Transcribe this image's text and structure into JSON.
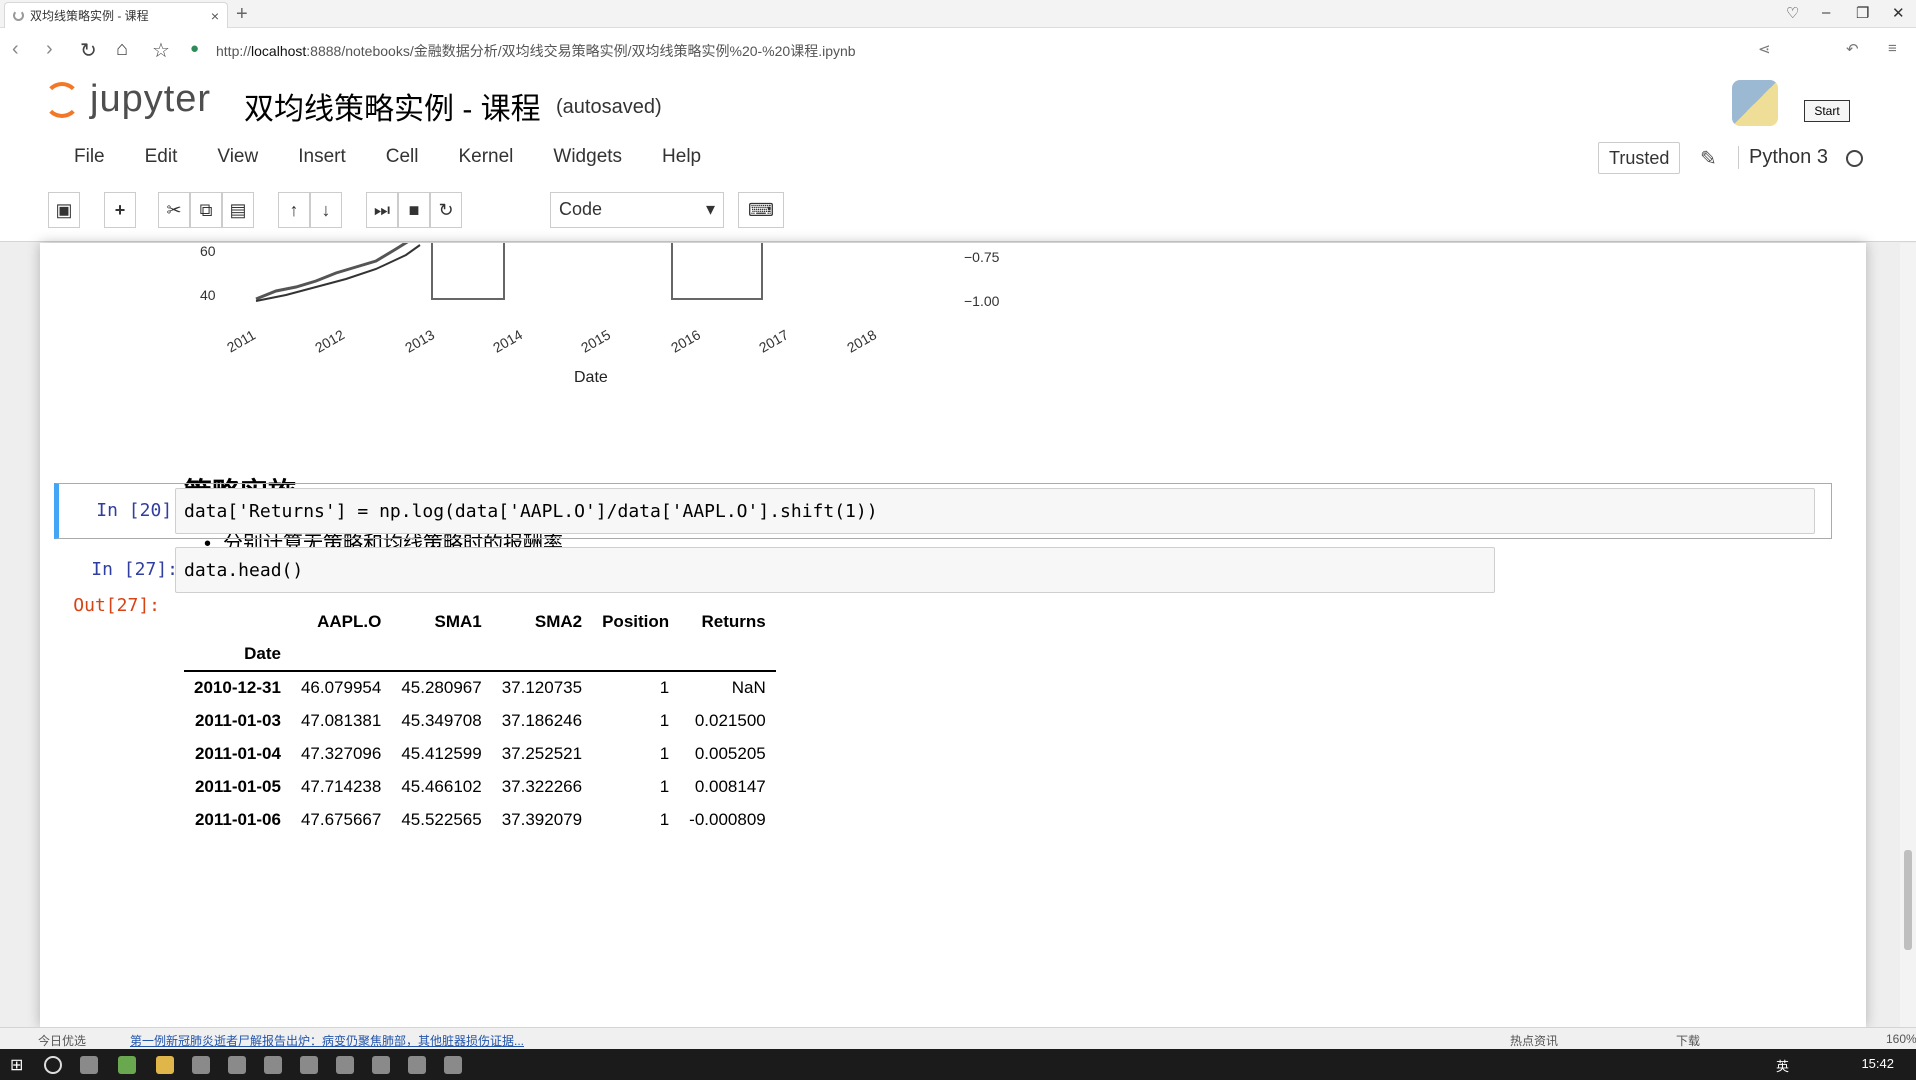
{
  "browser": {
    "tab_title": "双均线策略实例 - 课程",
    "new_tab": "+",
    "tab_close": "×",
    "url_prefix": "http://",
    "url_host": "localhost",
    "url_rest": ":8888/notebooks/金融数据分析/双均线交易策略实例/双均线策略实例%20-%20课程.ipynb"
  },
  "jupyter": {
    "logo_text": "jupyter",
    "notebook_title": "双均线策略实例 - 课程",
    "save_status": "(autosaved)",
    "start_label": "Start",
    "menu": [
      "File",
      "Edit",
      "View",
      "Insert",
      "Cell",
      "Kernel",
      "Widgets",
      "Help"
    ],
    "trusted_label": "Trusted",
    "kernel_name": "Python 3",
    "cell_type": "Code"
  },
  "plot": {
    "y_ticks_left": [
      "60",
      "40"
    ],
    "y_ticks_right": [
      "−0.75",
      "−1.00"
    ],
    "x_ticks": [
      "2011",
      "2012",
      "2013",
      "2014",
      "2015",
      "2016",
      "2017",
      "2018"
    ],
    "x_label": "Date"
  },
  "markdown": {
    "heading": "策略实施",
    "bullet": "分别计算无策略和均线策略时的报酬率"
  },
  "cells": [
    {
      "prompt": "In  [20]:",
      "code": "data['Returns'] = np.log(data['AAPL.O']/data['AAPL.O'].shift(1))"
    },
    {
      "prompt": "In  [27]:",
      "code": "data.head()",
      "out_prompt": "Out[27]:"
    }
  ],
  "dataframe": {
    "columns": [
      "AAPL.O",
      "SMA1",
      "SMA2",
      "Position",
      "Returns"
    ],
    "index_name": "Date",
    "rows": [
      {
        "date": "2010-12-31",
        "values": [
          "46.079954",
          "45.280967",
          "37.120735",
          "1",
          "NaN"
        ]
      },
      {
        "date": "2011-01-03",
        "values": [
          "47.081381",
          "45.349708",
          "37.186246",
          "1",
          "0.021500"
        ]
      },
      {
        "date": "2011-01-04",
        "values": [
          "47.327096",
          "45.412599",
          "37.252521",
          "1",
          "0.005205"
        ]
      },
      {
        "date": "2011-01-05",
        "values": [
          "47.714238",
          "45.466102",
          "37.322266",
          "1",
          "0.008147"
        ]
      },
      {
        "date": "2011-01-06",
        "values": [
          "47.675667",
          "45.522565",
          "37.392079",
          "1",
          "-0.000809"
        ]
      }
    ]
  },
  "statusbar": {
    "left": "今日优选",
    "news": "第一例新冠肺炎逝者尸解报告出炉：病变仍聚焦肺部，其他脏器损伤证据...",
    "hot": "热点资讯",
    "download": "下载",
    "zoom": "160%"
  },
  "taskbar": {
    "ime": "英",
    "clock": "15:42"
  }
}
